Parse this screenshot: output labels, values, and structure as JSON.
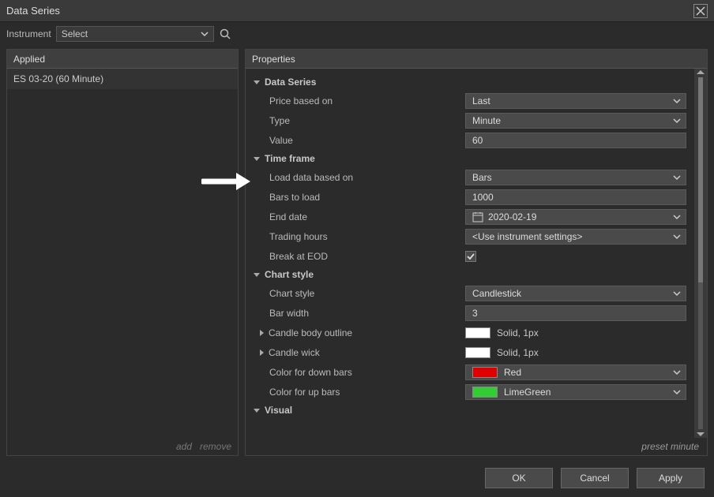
{
  "window": {
    "title": "Data Series"
  },
  "instrument": {
    "label": "Instrument",
    "selected": "Select"
  },
  "applied": {
    "header": "Applied",
    "items": [
      "ES 03-20 (60 Minute)"
    ],
    "add": "add",
    "remove": "remove"
  },
  "properties": {
    "header": "Properties",
    "preset": "preset minute",
    "sections": {
      "data_series": {
        "title": "Data Series",
        "price_based_on": {
          "label": "Price based on",
          "value": "Last"
        },
        "type": {
          "label": "Type",
          "value": "Minute"
        },
        "value": {
          "label": "Value",
          "value": "60"
        }
      },
      "time_frame": {
        "title": "Time frame",
        "load_data_based_on": {
          "label": "Load data based on",
          "value": "Bars"
        },
        "bars_to_load": {
          "label": "Bars to load",
          "value": "1000"
        },
        "end_date": {
          "label": "End date",
          "value": "2020-02-19"
        },
        "trading_hours": {
          "label": "Trading hours",
          "value": "<Use instrument settings>"
        },
        "break_at_eod": {
          "label": "Break at EOD",
          "checked": true
        }
      },
      "chart_style": {
        "title": "Chart style",
        "chart_style": {
          "label": "Chart style",
          "value": "Candlestick"
        },
        "bar_width": {
          "label": "Bar width",
          "value": "3"
        },
        "candle_body_outline": {
          "label": "Candle body outline",
          "value": "Solid, 1px",
          "swatch": "sw-white"
        },
        "candle_wick": {
          "label": "Candle wick",
          "value": "Solid, 1px",
          "swatch": "sw-white"
        },
        "color_down": {
          "label": "Color for down bars",
          "value": "Red",
          "swatch": "sw-red"
        },
        "color_up": {
          "label": "Color for up bars",
          "value": "LimeGreen",
          "swatch": "sw-limegreen"
        }
      },
      "visual": {
        "title": "Visual"
      }
    }
  },
  "buttons": {
    "ok": "OK",
    "cancel": "Cancel",
    "apply": "Apply"
  }
}
